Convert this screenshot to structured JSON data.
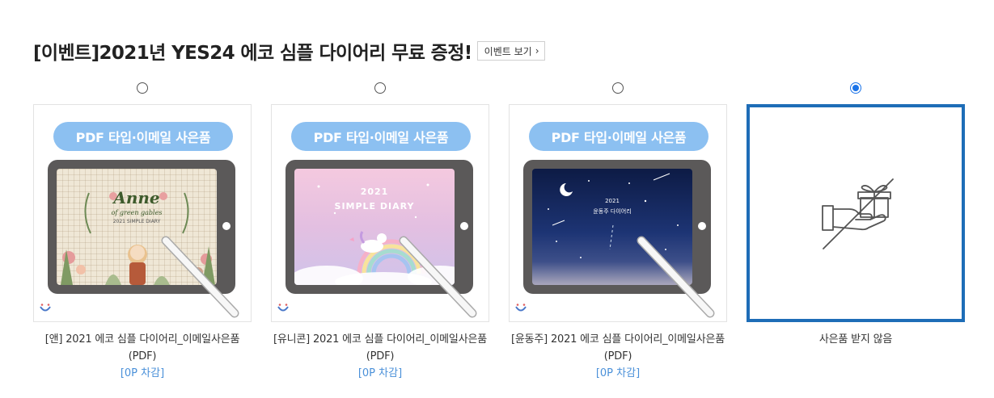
{
  "header": {
    "title": "[이벤트]2021년 YES24 에코 심플 다이어리 무료 증정!",
    "event_button_label": "이벤트 보기"
  },
  "gifts": [
    {
      "selected": false,
      "banner": "PDF 타입·이메일 사은품",
      "cover_title": "Anne",
      "cover_subtitle": "of green gables",
      "cover_line": "2021 SIMPLE DIARY",
      "caption": "[앤] 2021 에코 심플 다이어리_이메일사은품(PDF)",
      "price": "[0P 차감]"
    },
    {
      "selected": false,
      "banner": "PDF 타입·이메일 사은품",
      "cover_title": "2021",
      "cover_subtitle": "SIMPLE DIARY",
      "caption": "[유니콘] 2021 에코 심플 다이어리_이메일사은품(PDF)",
      "price": "[0P 차감]"
    },
    {
      "selected": false,
      "banner": "PDF 타입·이메일 사은품",
      "cover_title": "2021",
      "cover_subtitle": "윤동주 다이어리",
      "caption": "[윤동주] 2021 에코 심플 다이어리_이메일사은품(PDF)",
      "price": "[0P 차감]"
    },
    {
      "selected": true,
      "caption": "사은품 받지 않음"
    }
  ],
  "colors": {
    "accent": "#1e6db7",
    "banner": "#8cc0f1",
    "price": "#4a90d9",
    "radio_checked": "#1a73e8"
  },
  "icons": {
    "event_button": "chevron-right-icon",
    "brand_mark": "smile-logo-icon",
    "no_gift": "no-gift-hand-icon"
  }
}
